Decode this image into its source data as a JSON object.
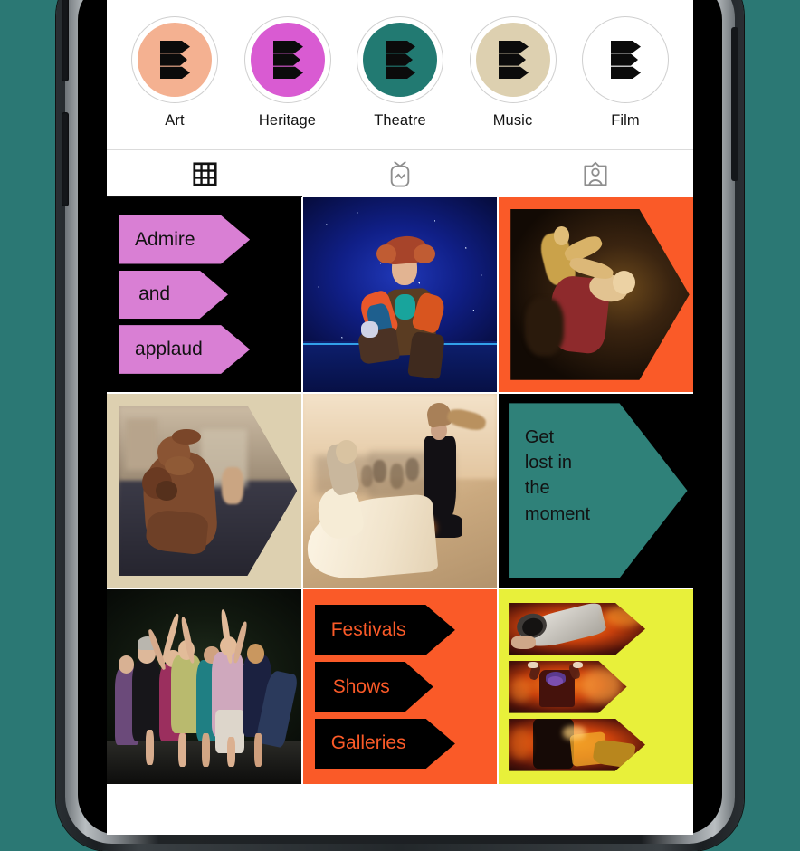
{
  "app": {
    "name": "Instagram profile grid",
    "brand_name": "B",
    "background_color": "#2b7874"
  },
  "stories": {
    "items": [
      {
        "label": "Art",
        "color": "#f4b191",
        "icon": "brand-arrows-logo-icon"
      },
      {
        "label": "Heritage",
        "color": "#d95bd2",
        "icon": "brand-arrows-logo-icon"
      },
      {
        "label": "Theatre",
        "color": "#227a72",
        "icon": "brand-arrows-logo-icon"
      },
      {
        "label": "Music",
        "color": "#ddd0b0",
        "icon": "brand-arrows-logo-icon"
      },
      {
        "label": "Film",
        "color": "#ffffff",
        "icon": "brand-arrows-logo-icon"
      }
    ]
  },
  "tabs": {
    "items": [
      {
        "name": "grid",
        "icon": "grid-icon",
        "active": true
      },
      {
        "name": "reels",
        "icon": "igtv-icon",
        "active": false
      },
      {
        "name": "tagged",
        "icon": "tagged-person-icon",
        "active": false
      }
    ],
    "active_index": 0
  },
  "grid": {
    "cells": [
      {
        "id": "cell-admire",
        "type": "text-arrows",
        "background": "#000000",
        "chip_color": "#d97fd4",
        "text_color": "#121212",
        "lines": [
          "Admire",
          "and",
          "applaud"
        ]
      },
      {
        "id": "cell-theatre-photo",
        "type": "photo",
        "alt": "Actor in patchwork coat and cap kneeling on a blue-lit stage with falling snow"
      },
      {
        "id": "cell-dance-arrow",
        "type": "photo-arrow",
        "background": "#fa5a28",
        "alt": "Two dancers lit in warm gold against a dark stage, clipped to an arrow shape"
      },
      {
        "id": "cell-sculpture-arrow",
        "type": "photo-arrow",
        "background": "#ddd0b0",
        "alt": "Bronze sculpture of an embracing figure in a museum gallery, clipped to an arrow shape"
      },
      {
        "id": "cell-festival-photo",
        "type": "photo",
        "alt": "Outdoor performance, dancer in black on a plank with orange smoke and a long white paper train"
      },
      {
        "id": "cell-getlost",
        "type": "text-big-arrow",
        "background": "#000000",
        "chip_color": "#2f8179",
        "text_color": "#121212",
        "lines": [
          "Get",
          "lost in",
          "the",
          "moment"
        ]
      },
      {
        "id": "cell-group-photo",
        "type": "photo",
        "alt": "Large group of dancers of mixed ages reaching upward on a dark stage"
      },
      {
        "id": "cell-festivals",
        "type": "text-arrows",
        "background": "#fa5a28",
        "chip_color": "#000000",
        "text_color": "#fa5a28",
        "lines": [
          "Festivals",
          "Shows",
          "Galleries"
        ]
      },
      {
        "id": "cell-fire-arrows",
        "type": "photo-arrows",
        "background": "#e8f03a",
        "alt": "Fire and pyrotechnic street performance seen through three arrow shaped windows"
      }
    ]
  }
}
